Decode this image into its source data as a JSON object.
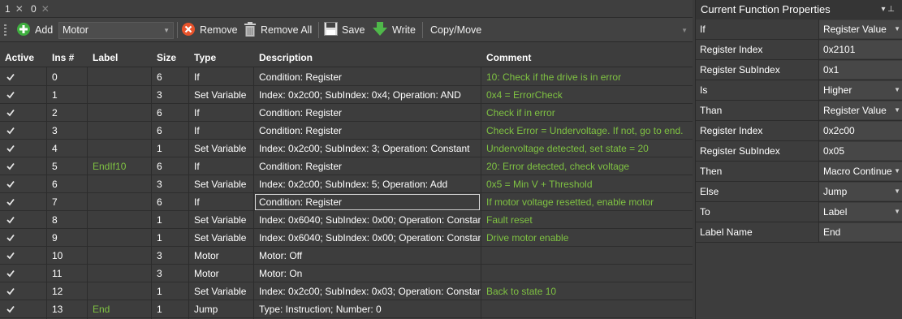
{
  "tabs": [
    {
      "label": "1",
      "close": "✕"
    },
    {
      "label": "0",
      "close": "✕"
    }
  ],
  "toolbar": {
    "add_label": "Add",
    "combo_value": "Motor",
    "remove_label": "Remove",
    "remove_all_label": "Remove All",
    "save_label": "Save",
    "write_label": "Write",
    "copy_move_label": "Copy/Move"
  },
  "table": {
    "columns": [
      "Active",
      "Ins #",
      "Label",
      "Size",
      "Type",
      "Description",
      "Comment"
    ],
    "rows": [
      {
        "active": true,
        "ins": "0",
        "label": "",
        "size": "6",
        "type": "If",
        "description": "Condition: Register",
        "comment": "10: Check if the drive is in error"
      },
      {
        "active": true,
        "ins": "1",
        "label": "",
        "size": "3",
        "type": "Set Variable",
        "description": "Index: 0x2c00; SubIndex: 0x4; Operation: AND",
        "comment": "0x4 = ErrorCheck"
      },
      {
        "active": true,
        "ins": "2",
        "label": "",
        "size": "6",
        "type": "If",
        "description": "Condition: Register",
        "comment": "Check if in error"
      },
      {
        "active": true,
        "ins": "3",
        "label": "",
        "size": "6",
        "type": "If",
        "description": "Condition: Register",
        "comment": "Check Error = Undervoltage. If not, go to end."
      },
      {
        "active": true,
        "ins": "4",
        "label": "",
        "size": "1",
        "type": "Set Variable",
        "description": "Index: 0x2c00; SubIndex: 3; Operation: Constant",
        "comment": "Undervoltage detected, set state = 20"
      },
      {
        "active": true,
        "ins": "5",
        "label": "EndIf10",
        "size": "6",
        "type": "If",
        "description": "Condition: Register",
        "comment": "20: Error detected, check voltage"
      },
      {
        "active": true,
        "ins": "6",
        "label": "",
        "size": "3",
        "type": "Set Variable",
        "description": "Index: 0x2c00; SubIndex: 5; Operation: Add",
        "comment": "0x5 = Min V + Threshold"
      },
      {
        "active": true,
        "ins": "7",
        "label": "",
        "size": "6",
        "type": "If",
        "description": "Condition: Register",
        "comment": "If motor voltage resetted, enable motor"
      },
      {
        "active": true,
        "ins": "8",
        "label": "",
        "size": "1",
        "type": "Set Variable",
        "description": "Index: 0x6040; SubIndex: 0x00; Operation: Constant",
        "comment": "Fault reset"
      },
      {
        "active": true,
        "ins": "9",
        "label": "",
        "size": "1",
        "type": "Set Variable",
        "description": "Index: 0x6040; SubIndex: 0x00; Operation: Constant",
        "comment": "Drive motor enable"
      },
      {
        "active": true,
        "ins": "10",
        "label": "",
        "size": "3",
        "type": "Motor",
        "description": "Motor: Off",
        "comment": ""
      },
      {
        "active": true,
        "ins": "11",
        "label": "",
        "size": "3",
        "type": "Motor",
        "description": "Motor: On",
        "comment": ""
      },
      {
        "active": true,
        "ins": "12",
        "label": "",
        "size": "1",
        "type": "Set Variable",
        "description": "Index: 0x2c00; SubIndex: 0x03; Operation: Constant",
        "comment": "Back to state 10"
      },
      {
        "active": true,
        "ins": "13",
        "label": "End",
        "size": "1",
        "type": "Jump",
        "description": "Type: Instruction; Number: 0",
        "comment": ""
      }
    ]
  },
  "properties": {
    "title": "Current Function Properties",
    "pin_icons": "▾ ⊥",
    "items": [
      {
        "label": "If",
        "value": "Register Value",
        "dropdown": true
      },
      {
        "label": "Register Index",
        "value": "0x2101",
        "dropdown": false
      },
      {
        "label": "Register SubIndex",
        "value": "0x1",
        "dropdown": false
      },
      {
        "label": "Is",
        "value": "Higher",
        "dropdown": true
      },
      {
        "label": "Than",
        "value": "Register Value",
        "dropdown": true
      },
      {
        "label": "Register Index",
        "value": "0x2c00",
        "dropdown": false
      },
      {
        "label": "Register SubIndex",
        "value": "0x05",
        "dropdown": false
      },
      {
        "label": "Then",
        "value": "Macro Continue",
        "dropdown": true
      },
      {
        "label": "Else",
        "value": "Jump",
        "dropdown": true
      },
      {
        "label": "To",
        "value": "Label",
        "dropdown": true
      },
      {
        "label": "Label Name",
        "value": "End",
        "dropdown": false
      }
    ]
  },
  "colors": {
    "comment": "#7fc242",
    "label": "#7fc242",
    "add": "#3fae3f",
    "remove": "#e8532b",
    "write": "#4fb84a"
  }
}
